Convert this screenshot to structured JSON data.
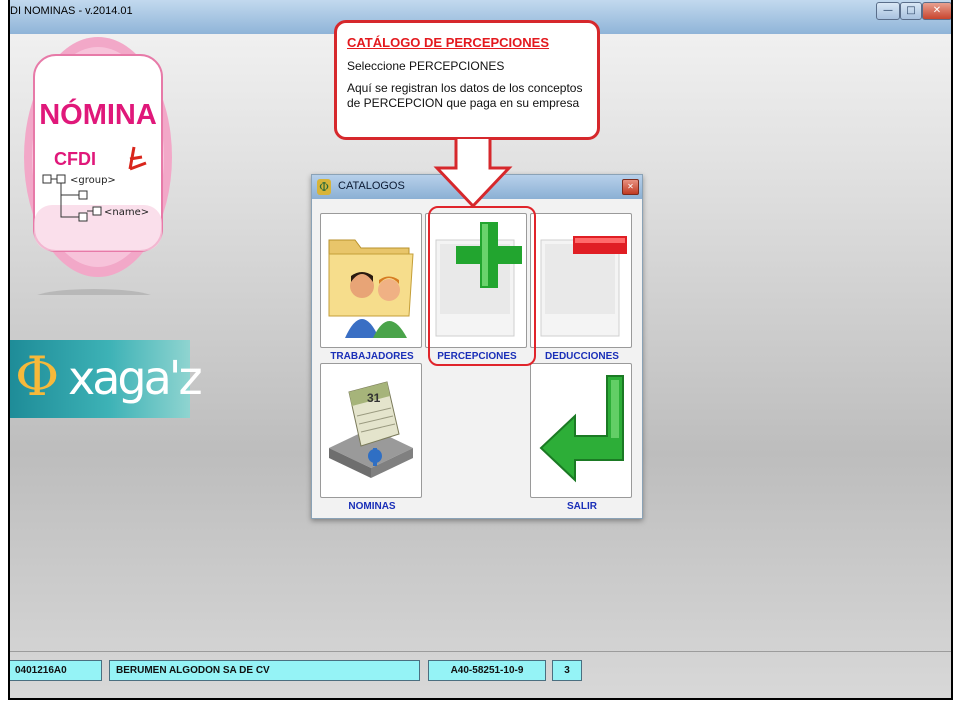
{
  "window": {
    "title": "DI NOMINAS - v.2014.01"
  },
  "logos": {
    "nomina_text": "NÓMINA",
    "cfdi_text": "CFDI",
    "group_tag": "<group>",
    "name_tag": "<name>",
    "xaga_text": "xaga'z"
  },
  "callout": {
    "title": "CATÁLOGO DE PERCEPCIONES",
    "line1": "Seleccione PERCEPCIONES",
    "line2": "Aquí se registran los datos de los conceptos de PERCEPCION que paga en su empresa"
  },
  "dialog": {
    "title": "CATALOGOS",
    "tiles": {
      "trabajadores": "TRABAJADORES",
      "percepciones": "PERCEPCIONES",
      "deducciones": "DEDUCCIONES",
      "nominas": "NOMINAS",
      "salir": "SALIR"
    },
    "calendar_day": "31"
  },
  "status": {
    "rfc": "0401216A0",
    "empresa": "BERUMEN ALGODON SA DE CV",
    "registro": "A40-58251-10-9",
    "numero": "3"
  },
  "colors": {
    "highlight": "#e0242b",
    "tile_label": "#1a2fb8",
    "status_field": "#95f3f6"
  }
}
